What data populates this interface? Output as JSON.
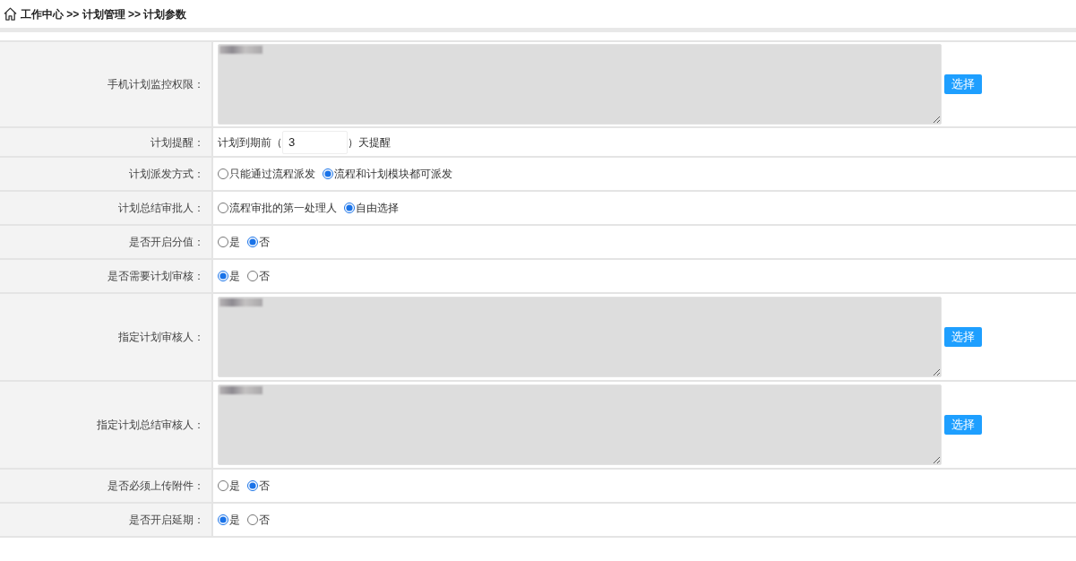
{
  "breadcrumb": "工作中心 >> 计划管理 >> 计划参数",
  "rows": [
    {
      "kind": "picker",
      "label": "手机计划监控权限：",
      "redacted": true,
      "button": "选择"
    },
    {
      "kind": "days",
      "label": "计划提醒：",
      "before": "计划到期前（",
      "value": "3",
      "after": "）天提醒"
    },
    {
      "kind": "radio",
      "label": "计划派发方式：",
      "options": [
        {
          "label": "只能通过流程派发",
          "selected": false
        },
        {
          "label": "流程和计划模块都可派发",
          "selected": true
        }
      ]
    },
    {
      "kind": "radio",
      "label": "计划总结审批人：",
      "options": [
        {
          "label": "流程审批的第一处理人",
          "selected": false
        },
        {
          "label": "自由选择",
          "selected": true
        }
      ]
    },
    {
      "kind": "radio",
      "label": "是否开启分值：",
      "options": [
        {
          "label": "是",
          "selected": false
        },
        {
          "label": "否",
          "selected": true
        }
      ]
    },
    {
      "kind": "radio",
      "label": "是否需要计划审核：",
      "options": [
        {
          "label": "是",
          "selected": true
        },
        {
          "label": "否",
          "selected": false
        }
      ]
    },
    {
      "kind": "picker",
      "label": "指定计划审核人：",
      "redacted": true,
      "button": "选择"
    },
    {
      "kind": "picker",
      "label": "指定计划总结审核人：",
      "redacted": true,
      "button": "选择"
    },
    {
      "kind": "radio",
      "label": "是否必须上传附件：",
      "options": [
        {
          "label": "是",
          "selected": false
        },
        {
          "label": "否",
          "selected": true
        }
      ]
    },
    {
      "kind": "radio",
      "label": "是否开启延期：",
      "options": [
        {
          "label": "是",
          "selected": true
        },
        {
          "label": "否",
          "selected": false
        }
      ]
    }
  ]
}
